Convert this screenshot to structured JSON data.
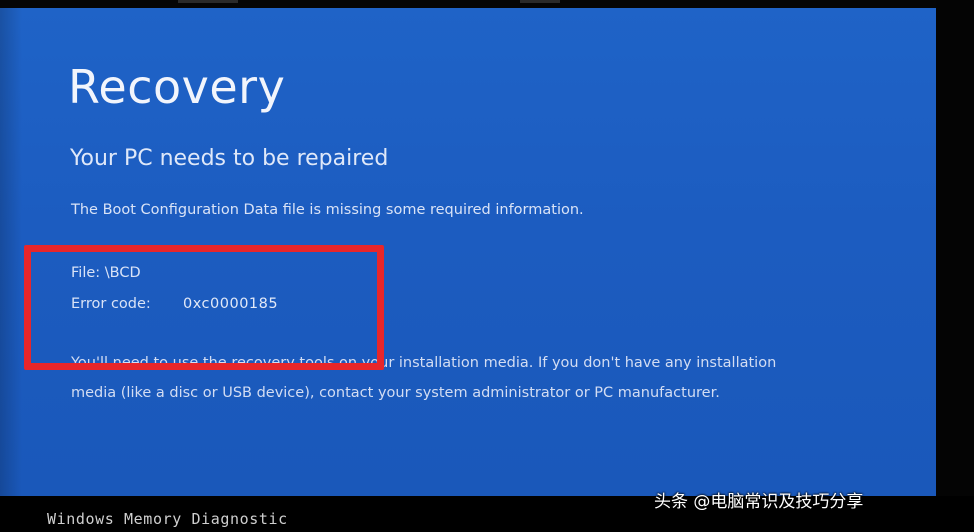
{
  "screen": {
    "title": "Recovery",
    "subtitle": "Your PC needs to be repaired",
    "message": "The Boot Configuration Data file is missing some required information.",
    "file_label": "File:",
    "file_value": "\\BCD",
    "error_label": "Error code:",
    "error_value": "0xc0000185",
    "help_line_1": "You'll need to use the recovery tools on your installation media. If you don't have any installation",
    "help_line_2": "media (like a disc or USB device), contact your system administrator or PC manufacturer."
  },
  "console": {
    "text": "Windows Memory Diagnostic"
  },
  "watermark": {
    "text": "头条 @电脑常识及技巧分享"
  },
  "colors": {
    "bsod_blue": "#1c5cc0",
    "highlight_red": "#e8262a",
    "text": "#e8eefb"
  }
}
